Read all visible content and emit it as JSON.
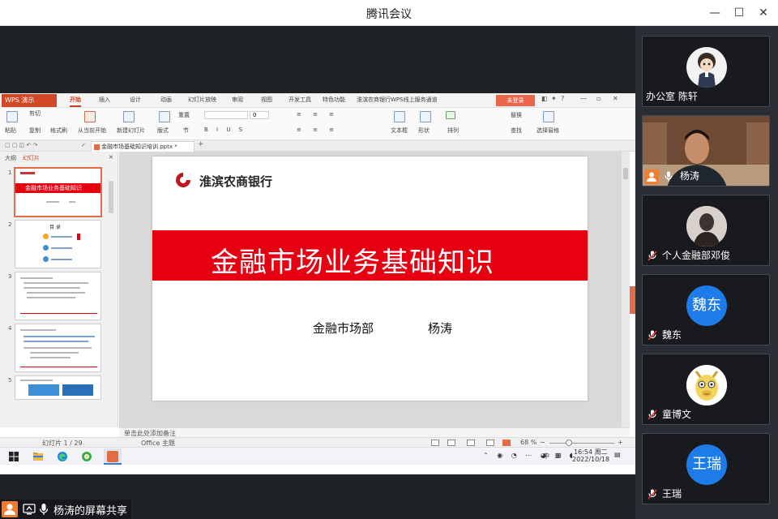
{
  "window": {
    "title": "腾讯会议",
    "minimize": "—",
    "maximize": "☐",
    "close": "✕"
  },
  "wps": {
    "logo": "WPS 演示",
    "tabs": [
      "开始",
      "插入",
      "设计",
      "动画",
      "幻灯片放映",
      "审阅",
      "视图",
      "开发工具",
      "特色功能",
      "淮滨农商银行WPS线上服务通道"
    ],
    "badge": "未登录",
    "ribbon": {
      "paste": "粘贴",
      "cut": "剪切",
      "copy": "复制",
      "format_painter": "格式刷",
      "play_from_current": "从当前开始",
      "new_slide": "新建幻灯片",
      "layout": "版式",
      "section": "节",
      "reset": "重置",
      "font_size": "0",
      "textbox": "文本框",
      "shape": "形状",
      "arrange": "排列",
      "replace": "替换",
      "find": "查找",
      "select_pane": "选择窗格"
    },
    "doc_tab": "金融市场基础知识培训.pptx *",
    "panel_tabs": {
      "outline": "大纲",
      "slides": "幻灯片"
    },
    "thumbs": [
      {
        "num": "1",
        "title": "金融市场业务基础知识"
      },
      {
        "num": "2",
        "title": "目  录"
      },
      {
        "num": "3"
      },
      {
        "num": "4"
      },
      {
        "num": "5"
      }
    ],
    "slide": {
      "bank_name": "淮滨农商银行",
      "title": "金融市场业务基础知识",
      "department": "金融市场部",
      "author": "杨涛"
    },
    "notes_placeholder": "单击此处添加备注",
    "status": {
      "slide_counter": "幻灯片 1 / 29",
      "theme": "Office 主题",
      "zoom": "68 %"
    }
  },
  "taskbar": {
    "time": "16:54 周二",
    "date": "2022/10/18",
    "ime": "中"
  },
  "share_label": "杨涛的屏幕共享",
  "participants": [
    {
      "name": "办公室 陈轩",
      "avatar": "cartoon-character"
    },
    {
      "name": "杨涛",
      "avatar": "video"
    },
    {
      "name": "个人金融部邓俊",
      "avatar": "silhouette-photo"
    },
    {
      "name": "魏东",
      "avatar_text": "魏东",
      "color": "#1e7bea"
    },
    {
      "name": "童博文",
      "avatar": "cartoon-alpaca"
    },
    {
      "name": "王瑞",
      "avatar_text": "王瑞",
      "color": "#1e7bea"
    }
  ],
  "colors": {
    "accent_red": "#e60012",
    "wps_orange": "#d24726",
    "avatar_blue": "#1e7bea"
  }
}
